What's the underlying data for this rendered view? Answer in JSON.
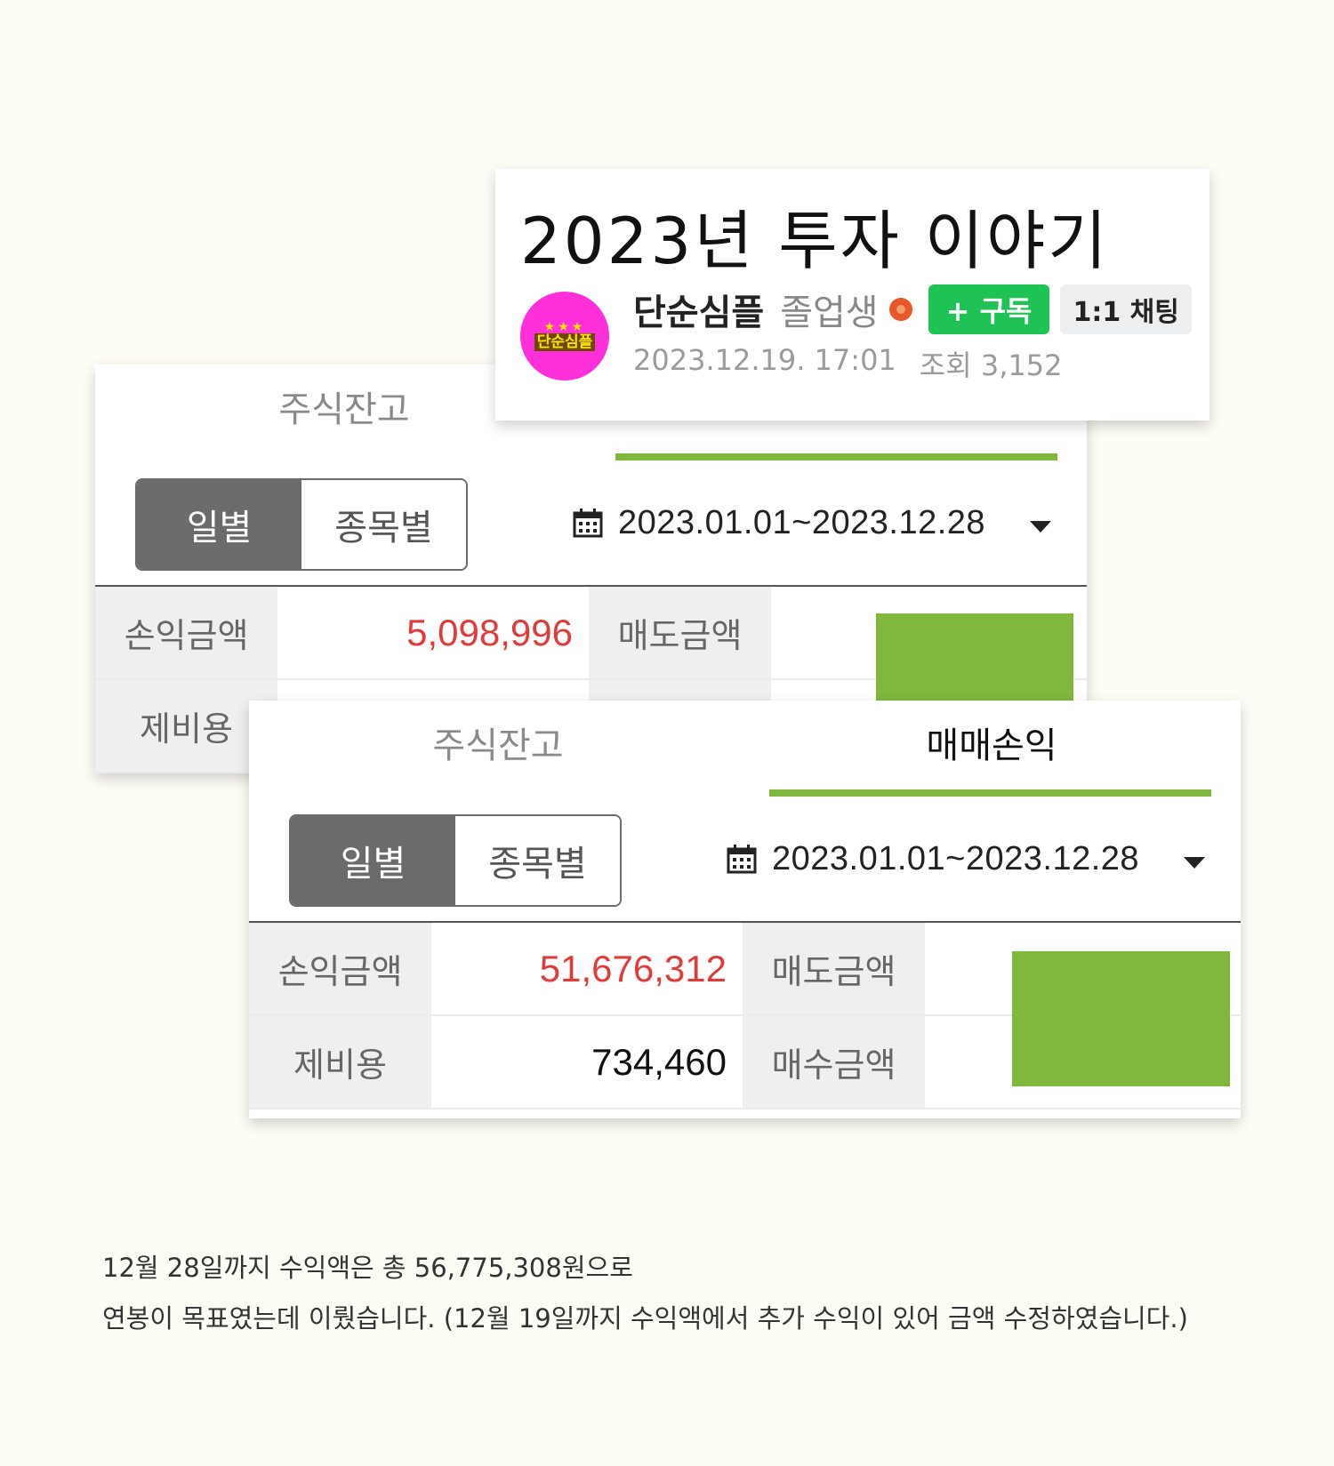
{
  "post": {
    "title": "2023년 투자 이야기",
    "author": "단순심플",
    "rank": "졸업생",
    "subscribe_label": "+ 구독",
    "chat_label": "1:1 채팅",
    "date": "2023.12.19. 17:01",
    "views": "조회 3,152",
    "avatar_stars": "★★★",
    "avatar_text": "단순심플"
  },
  "back_card": {
    "tab_balance": "주식잔고",
    "seg_daily": "일별",
    "seg_by_stock": "종목별",
    "date_range": "2023.01.01~2023.12.28",
    "profit_label": "손익금액",
    "profit_value": "5,098,996",
    "sell_label": "매도금액",
    "fee_label": "제비용"
  },
  "front_card": {
    "tab_balance": "주식잔고",
    "tab_pnl": "매매손익",
    "seg_daily": "일별",
    "seg_by_stock": "종목별",
    "date_range": "2023.01.01~2023.12.28",
    "profit_label": "손익금액",
    "profit_value": "51,676,312",
    "sell_label": "매도금액",
    "fee_label": "제비용",
    "fee_value": "734,460",
    "buy_label": "매수금액"
  },
  "caption": {
    "line1": "12월 28일까지 수익액은 총 56,775,308원으로",
    "line2": "연봉이 목표였는데 이뤘습니다. (12월 19일까지 수익액에서 추가 수익이 있어 금액 수정하였습니다.)"
  },
  "colors": {
    "accent_green": "#7fb83d",
    "profit_red": "#e03a3a",
    "subscribe_green": "#1fc255",
    "avatar_pink": "#ff2fd9"
  }
}
